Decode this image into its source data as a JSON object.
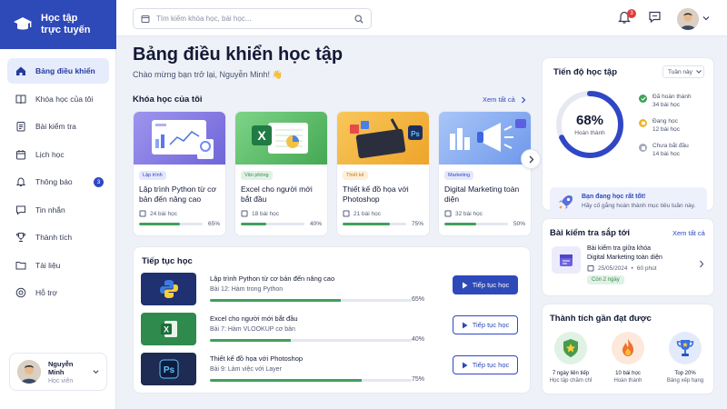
{
  "app": {
    "logo_line1": "Học tập",
    "logo_line2": "trực tuyến"
  },
  "sidebar": {
    "items": [
      {
        "label": "Bảng điều khiển",
        "icon": "home-icon",
        "active": true
      },
      {
        "label": "Khóa học của tôi",
        "icon": "book-icon"
      },
      {
        "label": "Bài kiểm tra",
        "icon": "quiz-icon"
      },
      {
        "label": "Lịch học",
        "icon": "calendar-icon"
      },
      {
        "label": "Thông báo",
        "icon": "bell-icon",
        "badge": "3"
      },
      {
        "label": "Tin nhắn",
        "icon": "chat-icon"
      },
      {
        "label": "Thành tích",
        "icon": "trophy-icon"
      },
      {
        "label": "Tài liệu",
        "icon": "folder-icon"
      },
      {
        "label": "Hỗ trợ",
        "icon": "help-icon"
      }
    ],
    "user": {
      "name": "Nguyễn Minh",
      "role": "Học viên"
    }
  },
  "topbar": {
    "search_placeholder": "Tìm kiếm khóa học, bài học...",
    "notif_count": "3"
  },
  "header": {
    "title": "Bảng điều khiển học tập",
    "welcome": "Chào mừng bạn trở lại, Nguyễn Minh! 👋"
  },
  "my_courses": {
    "title": "Khóa học của tôi",
    "see_all": "Xem tất cả",
    "items": [
      {
        "tag": "Lập trình",
        "title": "Lập trình Python từ cơ bản đến nâng cao",
        "lessons": "24 bài học",
        "percent": "65%",
        "progress": 0.65,
        "tag_bg": "#e4e8fb",
        "tag_color": "#3047c5",
        "thumb": "#8f86e8"
      },
      {
        "tag": "Văn phòng",
        "title": "Excel cho người mới bắt đầu",
        "lessons": "18 bài học",
        "percent": "40%",
        "progress": 0.4,
        "tag_bg": "#e0f2e5",
        "tag_color": "#3c8a4f",
        "thumb": "#5fbf6a"
      },
      {
        "tag": "Thiết kế",
        "title": "Thiết kế đồ họa với Photoshop",
        "lessons": "21 bài học",
        "percent": "75%",
        "progress": 0.75,
        "tag_bg": "#fdefd8",
        "tag_color": "#c47a12",
        "thumb": "#f4b23a"
      },
      {
        "tag": "Marketing",
        "title": "Digital Marketing toàn diện",
        "lessons": "32 bài học",
        "percent": "50%",
        "progress": 0.5,
        "tag_bg": "#e4e8fb",
        "tag_color": "#3047c5",
        "thumb": "#7fa8f0"
      }
    ]
  },
  "continue": {
    "title": "Tiếp tục học",
    "items": [
      {
        "name": "Lập trình Python từ cơ bản đến nâng cao",
        "lesson": "Bài 12: Hàm trong Python",
        "percent": "65%",
        "progress": 0.65,
        "button": "Tiếp tục học",
        "primary": true,
        "thumb": "#1f3170"
      },
      {
        "name": "Excel cho người mới bắt đầu",
        "lesson": "Bài 7: Hàm VLOOKUP cơ bản",
        "percent": "40%",
        "progress": 0.4,
        "button": "Tiếp tục học",
        "primary": false,
        "thumb": "#2f8a4e"
      },
      {
        "name": "Thiết kế đồ họa với Photoshop",
        "lesson": "Bài 9: Làm việc với Layer",
        "percent": "75%",
        "progress": 0.75,
        "button": "Tiếp tục học",
        "primary": false,
        "thumb": "#1e2b52"
      }
    ]
  },
  "progress_panel": {
    "title": "Tiến độ học tập",
    "period": "Tuần này",
    "percent": "68%",
    "percent_label": "Hoàn thành",
    "value": 0.68,
    "legend": [
      {
        "label": "Đã hoàn thành",
        "value": "34 bài học",
        "color": "#3fa15a"
      },
      {
        "label": "Đang học",
        "value": "12 bài học",
        "color": "#f0b429"
      },
      {
        "label": "Chưa bắt đầu",
        "value": "14 bài học",
        "color": "#a4aabd"
      }
    ],
    "banner_title": "Bạn đang học rất tốt!",
    "banner_text": "Hãy cố gắng hoàn thành mục tiêu tuần này."
  },
  "exams": {
    "title": "Bài kiểm tra sắp tới",
    "see_all": "Xem tất cả",
    "item": {
      "name": "Bài kiểm tra giữa khóa",
      "course": "Digital Marketing toàn diện",
      "date": "25/05/2024",
      "duration": "60 phút",
      "badge": "Còn 2 ngày"
    }
  },
  "achievements": {
    "title": "Thành tích gần đạt được",
    "items": [
      {
        "line1": "7 ngày liên tiếp",
        "line2": "Học tập chăm chỉ",
        "color": "#dff2e4"
      },
      {
        "line1": "10 bài học",
        "line2": "Hoàn thành",
        "color": "#fde8dc"
      },
      {
        "line1": "Top 20%",
        "line2": "Bảng xếp hạng",
        "color": "#e3ebfb"
      }
    ]
  }
}
